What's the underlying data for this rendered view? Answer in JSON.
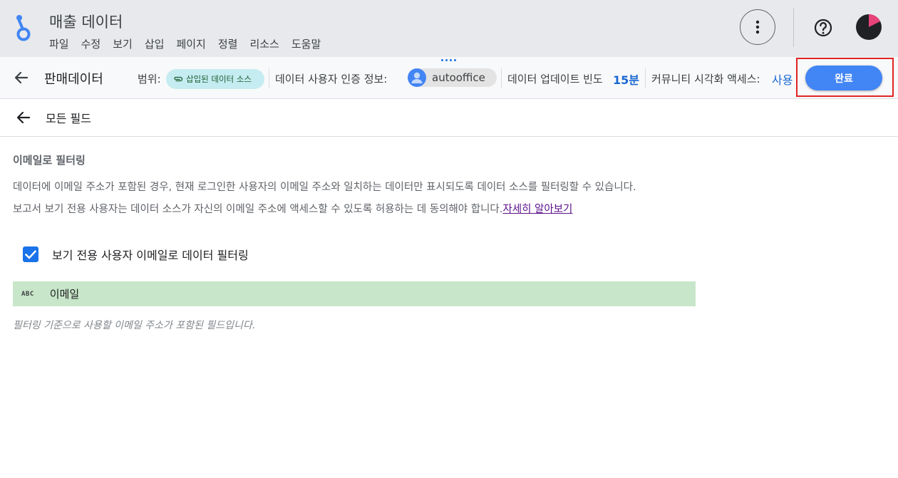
{
  "app": {
    "doc_title": "매출 데이터",
    "menu": [
      "파일",
      "수정",
      "보기",
      "삽입",
      "페이지",
      "정렬",
      "리소스",
      "도움말"
    ]
  },
  "toolbar": {
    "datasource_name": "판매데이터",
    "scope_label": "범위:",
    "scope_value": "삽입된 데이터 소스",
    "credentials_label": "데이터 사용자 인증 정보:",
    "credentials_value": "autooffice",
    "freshness_label": "데이터 업데이트 빈도",
    "freshness_value": "15분",
    "community_label": "커뮤니티 시각화 액세스:",
    "community_value": "사용",
    "done_label": "완료"
  },
  "fields": {
    "title": "모든 필드"
  },
  "email_filter": {
    "title": "이메일로 필터링",
    "desc_line1": "데이터에 이메일 주소가 포함된 경우, 현재 로그인한 사용자의 이메일 주소와 일치하는 데이터만 표시되도록 데이터 소스를 필터링할 수 있습니다.",
    "desc_line2": "보고서 보기 전용 사용자는 데이터 소스가 자신의 이메일 주소에 액세스할 수 있도록 허용하는 데 동의해야 합니다.",
    "learn_more": "자세히 알아보기",
    "checkbox_label": "보기 전용 사용자 이메일로 데이터 필터링",
    "checkbox_checked": true,
    "field_type": "ABC",
    "field_name": "이메일",
    "hint": "필터링 기준으로 사용할 이메일 주소가 포함된 필드입니다."
  },
  "colors": {
    "accent": "#4285f4",
    "link_blue": "#1967d2",
    "field_highlight": "#c8e6c9",
    "chip_scope": "#c5ecf1",
    "highlight_box": "#e02424"
  },
  "icons": [
    "app-logo-icon",
    "more-vert-icon",
    "help-icon",
    "avatar-icon",
    "back-arrow-icon",
    "attachment-icon",
    "person-icon",
    "check-icon"
  ]
}
